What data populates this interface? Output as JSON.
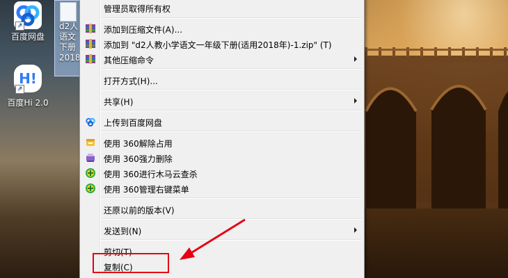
{
  "desktop": {
    "icons": [
      {
        "name": "baidu-netdisk",
        "label": "百度网盘",
        "color": "#2f7cf6"
      },
      {
        "name": "baidu-hi",
        "label": "百度Hi 2.0",
        "tile_text": "H!",
        "color": "#2f7cf6"
      }
    ],
    "selected_file": {
      "lines": [
        "d2人",
        "语文",
        "下册",
        "2018"
      ]
    }
  },
  "context_menu": {
    "items": [
      {
        "label": "管理员取得所有权",
        "icon": "",
        "submenu": false
      },
      {
        "label": "添加到压缩文件(A)...",
        "icon": "winrar-icon",
        "submenu": false
      },
      {
        "label": "添加到 \"d2人教小学语文一年级下册(适用2018年)-1.zip\" (T)",
        "icon": "winrar-icon",
        "submenu": false
      },
      {
        "label": "其他压缩命令",
        "icon": "winrar-icon",
        "submenu": true
      },
      {
        "label": "打开方式(H)...",
        "icon": "",
        "submenu": false
      },
      {
        "label": "共享(H)",
        "icon": "",
        "submenu": true
      },
      {
        "label": "上传到百度网盘",
        "icon": "baidu-cloud-icon",
        "submenu": false
      },
      {
        "label": "使用 360解除占用",
        "icon": "360-unlock-icon",
        "submenu": false
      },
      {
        "label": "使用 360强力删除",
        "icon": "360-shred-icon",
        "submenu": false
      },
      {
        "label": "使用 360进行木马云查杀",
        "icon": "360-scan-icon",
        "submenu": false
      },
      {
        "label": "使用 360管理右键菜单",
        "icon": "360-scan-icon",
        "submenu": false
      },
      {
        "label": "还原以前的版本(V)",
        "icon": "",
        "submenu": false
      },
      {
        "label": "发送到(N)",
        "icon": "",
        "submenu": true
      },
      {
        "label": "剪切(T)",
        "icon": "",
        "submenu": false
      },
      {
        "label": "复制(C)",
        "icon": "",
        "submenu": false
      }
    ]
  },
  "annotation": {
    "color": "#e60012"
  }
}
